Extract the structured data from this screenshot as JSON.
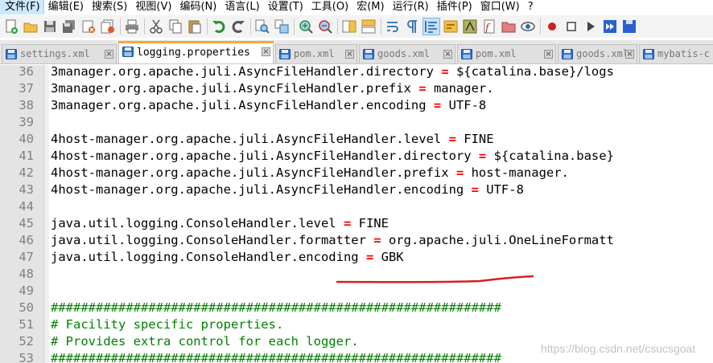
{
  "menubar": {
    "items": [
      "文件(F)",
      "编辑(E)",
      "搜索(S)",
      "视图(V)",
      "编码(N)",
      "语言(L)",
      "设置(T)",
      "工具(O)",
      "宏(M)",
      "运行(R)",
      "插件(P)",
      "窗口(W)",
      "?"
    ]
  },
  "toolbar": {
    "buttons": [
      "new-file-icon",
      "open-file-icon",
      "save-icon",
      "save-all-icon",
      "close-icon",
      "close-all-icon",
      "print-icon",
      "cut-icon",
      "copy-icon",
      "paste-icon",
      "undo-icon",
      "redo-icon",
      "find-icon",
      "replace-icon",
      "zoom-in-icon",
      "zoom-out-icon",
      "sync-vertical-icon",
      "sync-horizontal-icon",
      "word-wrap-icon",
      "show-all-chars-icon",
      "indent-guide-icon",
      "user-lang-icon",
      "doc-map-icon",
      "function-list-icon",
      "folder-workspace-icon",
      "monitor-icon",
      "record-macro-icon",
      "stop-macro-icon",
      "play-macro-icon",
      "run-macro-multiple-icon",
      "save-macro-icon"
    ]
  },
  "tabs": [
    {
      "label": "settings.xml",
      "active": false
    },
    {
      "label": "logging.properties",
      "active": true
    },
    {
      "label": "pom.xml",
      "active": false
    },
    {
      "label": "goods.xml",
      "active": false
    },
    {
      "label": "pom.xml",
      "active": false
    },
    {
      "label": "goods.xml",
      "active": false
    },
    {
      "label": "mybatis-c",
      "active": false
    }
  ],
  "editor": {
    "lines": [
      {
        "n": "36",
        "parts": [
          [
            "t",
            "3manager.org.apache.juli.AsyncFileHandler.directory "
          ],
          [
            "e",
            "="
          ],
          [
            "t",
            " ${catalina.base}/logs"
          ]
        ]
      },
      {
        "n": "37",
        "parts": [
          [
            "t",
            "3manager.org.apache.juli.AsyncFileHandler.prefix "
          ],
          [
            "e",
            "="
          ],
          [
            "t",
            " manager."
          ]
        ]
      },
      {
        "n": "38",
        "parts": [
          [
            "t",
            "3manager.org.apache.juli.AsyncFileHandler.encoding "
          ],
          [
            "e",
            "="
          ],
          [
            "t",
            " UTF-8"
          ]
        ]
      },
      {
        "n": "39",
        "parts": []
      },
      {
        "n": "40",
        "parts": [
          [
            "t",
            "4host-manager.org.apache.juli.AsyncFileHandler.level "
          ],
          [
            "e",
            "="
          ],
          [
            "t",
            " FINE"
          ]
        ]
      },
      {
        "n": "41",
        "parts": [
          [
            "t",
            "4host-manager.org.apache.juli.AsyncFileHandler.directory "
          ],
          [
            "e",
            "="
          ],
          [
            "t",
            " ${catalina.base}"
          ]
        ]
      },
      {
        "n": "42",
        "parts": [
          [
            "t",
            "4host-manager.org.apache.juli.AsyncFileHandler.prefix "
          ],
          [
            "e",
            "="
          ],
          [
            "t",
            " host-manager."
          ]
        ]
      },
      {
        "n": "43",
        "parts": [
          [
            "t",
            "4host-manager.org.apache.juli.AsyncFileHandler.encoding "
          ],
          [
            "e",
            "="
          ],
          [
            "t",
            " UTF-8"
          ]
        ]
      },
      {
        "n": "44",
        "parts": []
      },
      {
        "n": "45",
        "parts": [
          [
            "t",
            "java.util.logging.ConsoleHandler.level "
          ],
          [
            "e",
            "="
          ],
          [
            "t",
            " FINE"
          ]
        ]
      },
      {
        "n": "46",
        "parts": [
          [
            "t",
            "java.util.logging.ConsoleHandler.formatter "
          ],
          [
            "e",
            "="
          ],
          [
            "t",
            " org.apache.juli.OneLineFormatt"
          ]
        ]
      },
      {
        "n": "47",
        "parts": [
          [
            "t",
            "java.util.logging.ConsoleHandler.encoding "
          ],
          [
            "e",
            "="
          ],
          [
            "t",
            " GBK"
          ]
        ]
      },
      {
        "n": "48",
        "parts": []
      },
      {
        "n": "49",
        "parts": []
      },
      {
        "n": "50",
        "parts": [
          [
            "c",
            "############################################################"
          ]
        ]
      },
      {
        "n": "51",
        "parts": [
          [
            "c",
            "# Facility specific properties."
          ]
        ]
      },
      {
        "n": "52",
        "parts": [
          [
            "c",
            "# Provides extra control for each logger."
          ]
        ]
      },
      {
        "n": "53",
        "parts": [
          [
            "c",
            "############################################################"
          ]
        ]
      }
    ]
  },
  "watermark": "https://blog.csdn.net/csucsgoat",
  "colors": {
    "keyword_operator": "#ff0000",
    "comment": "#008000",
    "active_tab_accent": "#f8a83a",
    "annotation_stroke": "#d42020"
  }
}
